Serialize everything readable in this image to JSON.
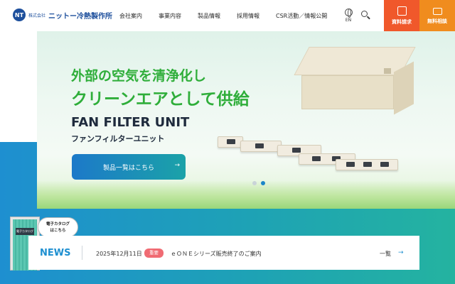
{
  "header": {
    "logo_mark": "NT",
    "logo_small": "株式会社",
    "logo_name": "ニットー冷熱製作所",
    "nav": [
      "会社案内",
      "事業内容",
      "製品情報",
      "採用情報",
      "CSR活動／情報公開"
    ],
    "lang_label": "EN",
    "cta_documents": "資料請求",
    "cta_catalog": "無料相談"
  },
  "hero": {
    "headline_1": "外部の空気を清浄化し",
    "headline_2": "クリーンエアとして供給",
    "product_name": "FAN FILTER UNIT",
    "product_sub": "ファンフィルターユニット",
    "button_label": "製品一覧はこちら",
    "button_arrow": "→",
    "slide_count": 2,
    "active_slide": 2
  },
  "catalog_widget": {
    "door_sign": "電子カタログ",
    "bubble_line_1": "電子カタログ",
    "bubble_line_2": "はこちら"
  },
  "news": {
    "title": "NEWS",
    "date": "2025年12月11日",
    "tag": "重要",
    "text": "ｅＯＮＥシリーズ販売終了のご案内",
    "more": "一覧",
    "arrow": "→"
  },
  "colors": {
    "brand_blue": "#1d4f9c",
    "headline_green": "#2fae3a",
    "cta_orange_red": "#f0582b",
    "cta_orange": "#f08c1e",
    "accent_blue": "#1e8fd0",
    "tag_pink": "#f06b73"
  },
  "icons": [
    "globe-icon",
    "search-icon",
    "document-icon",
    "mail-icon",
    "arrow-right-icon"
  ]
}
